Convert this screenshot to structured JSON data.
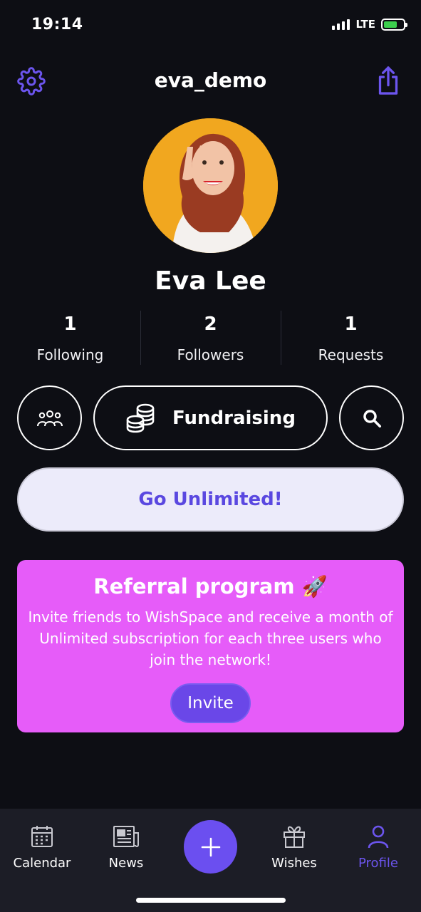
{
  "status_bar": {
    "time": "19:14",
    "network": "LTE"
  },
  "header": {
    "username": "eva_demo",
    "settings_icon": "gear-icon",
    "share_icon": "share-icon"
  },
  "profile": {
    "display_name": "Eva Lee"
  },
  "stats": [
    {
      "count": "1",
      "label": "Following"
    },
    {
      "count": "2",
      "label": "Followers"
    },
    {
      "count": "1",
      "label": "Requests"
    }
  ],
  "actions": {
    "fundraising_label": "Fundraising"
  },
  "upgrade": {
    "label": "Go Unlimited!"
  },
  "referral": {
    "title": "Referral program 🚀",
    "text": "Invite friends to WishSpace and receive a month of Unlimited subscription for each three users who join the network!",
    "invite_label": "Invite"
  },
  "tab_bar": {
    "items": [
      {
        "label": "Calendar",
        "icon": "calendar-icon"
      },
      {
        "label": "News",
        "icon": "newspaper-icon"
      },
      {
        "label": "Wishes",
        "icon": "gift-icon"
      },
      {
        "label": "Profile",
        "icon": "user-icon",
        "active": true
      }
    ]
  },
  "colors": {
    "accent": "#6b4ff0",
    "referral_bg": "#e65cf9",
    "background": "#0d0e14",
    "tab_bar_bg": "#1c1d26"
  }
}
